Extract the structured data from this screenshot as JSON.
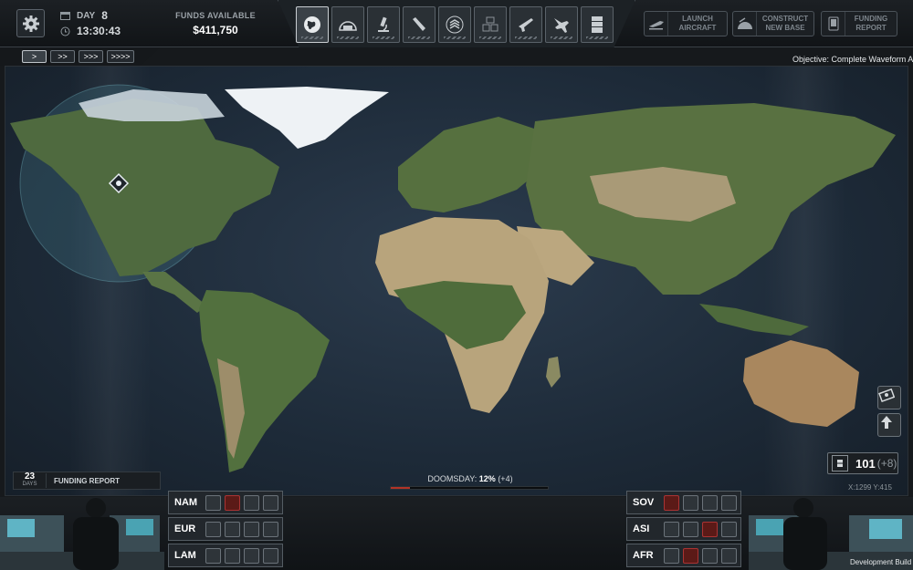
{
  "topbar": {
    "day_label": "DAY",
    "day_value": "8",
    "time": "13:30:43",
    "funds_label": "FUNDS AVAILABLE",
    "funds_value": "$411,750",
    "nav_icons": [
      "globe-icon",
      "base-icon",
      "research-icon",
      "engineering-icon",
      "soldiers-icon",
      "facilities-icon",
      "weapons-icon",
      "aircraft-icon",
      "archives-icon"
    ],
    "active_nav": "globe-icon",
    "launch_aircraft": "LAUNCH AIRCRAFT",
    "construct_new_base": "CONSTRUCT NEW BASE",
    "funding_report": "FUNDING REPORT"
  },
  "speed": {
    "buttons": [
      ">",
      ">>",
      ">>>",
      ">>>>"
    ],
    "active": 0
  },
  "objective": "Objective: Complete Waveform Ar",
  "map": {
    "land_color": "#5a6d44",
    "desert_color": "#b6a37e",
    "ice_color": "#e8eef3"
  },
  "science": {
    "value": "101",
    "delta": "(+8)"
  },
  "coords": "X:1299  Y:415",
  "doomsday": {
    "label": "DOOMSDAY:",
    "value": "12%",
    "delta": "(+4)",
    "progress": 0.12
  },
  "funding": {
    "days": "23",
    "days_unit": "DAYS",
    "label": "FUNDING REPORT"
  },
  "regions_left": [
    {
      "code": "NAM",
      "sats": [
        "normal",
        "red",
        "normal",
        "normal"
      ]
    },
    {
      "code": "EUR",
      "sats": [
        "normal",
        "normal",
        "normal",
        "normal"
      ]
    },
    {
      "code": "LAM",
      "sats": [
        "normal",
        "normal",
        "normal",
        "normal"
      ]
    }
  ],
  "regions_right": [
    {
      "code": "SOV",
      "sats": [
        "red",
        "normal",
        "normal",
        "normal"
      ]
    },
    {
      "code": "ASI",
      "sats": [
        "normal",
        "normal",
        "red",
        "normal"
      ]
    },
    {
      "code": "AFR",
      "sats": [
        "normal",
        "red",
        "normal",
        "normal"
      ]
    }
  ],
  "dev_build": "Development Build"
}
